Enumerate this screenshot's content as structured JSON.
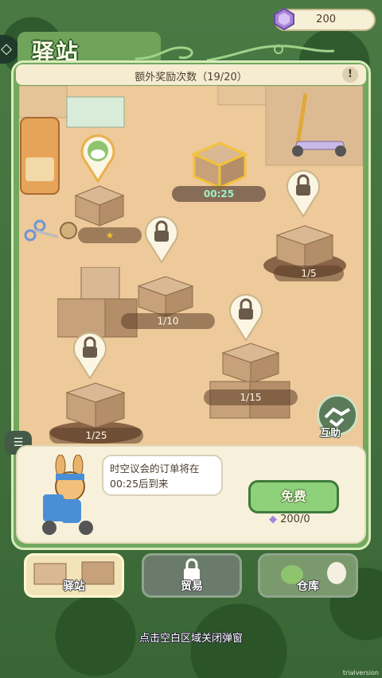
{
  "currency": {
    "icon": "gem-icon",
    "value": "200"
  },
  "header": {
    "title": "驿站"
  },
  "counter": {
    "text": "额外奖励次数（19/20）",
    "info": "!"
  },
  "slots": [
    {
      "label": "",
      "status": "star"
    },
    {
      "label": "00:25",
      "status": "timer"
    },
    {
      "label": "1/5",
      "status": "locked"
    },
    {
      "label": "1/10",
      "status": "locked"
    },
    {
      "label": "1/15",
      "status": "locked"
    },
    {
      "label": "1/25",
      "status": "locked"
    }
  ],
  "help": {
    "label": "互助"
  },
  "chat": {
    "message": "时空议会的订单将在00:25后到来"
  },
  "action": {
    "free_label": "免费",
    "cost": "200/0"
  },
  "tabs": [
    {
      "label": "驿站",
      "active": true
    },
    {
      "label": "贸易",
      "active": false
    },
    {
      "label": "仓库",
      "active": false
    }
  ],
  "footer": {
    "hint": "点击空白区域关闭弹窗"
  },
  "watermark": "trialversion",
  "colors": {
    "panel": "#72a85e",
    "floor": "#eec99a",
    "accent": "#8fd07a"
  }
}
